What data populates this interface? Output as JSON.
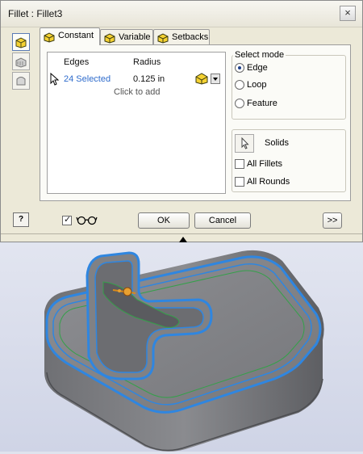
{
  "window": {
    "title": "Fillet : Fillet3",
    "close_glyph": "×"
  },
  "side_tools": [
    {
      "icon": "edge-fillet-icon",
      "active": true
    },
    {
      "icon": "face-fillet-icon",
      "active": false
    },
    {
      "icon": "full-round-fillet-icon",
      "active": false
    }
  ],
  "tabs": [
    {
      "label": "Constant",
      "active": true
    },
    {
      "label": "Variable",
      "active": false
    },
    {
      "label": "Setbacks",
      "active": false
    }
  ],
  "table": {
    "columns": [
      "Edges",
      "Radius"
    ],
    "rows": [
      {
        "edges": "24 Selected",
        "radius": "0.125 in"
      }
    ],
    "add_row_text": "Click to add"
  },
  "select_mode": {
    "title": "Select mode",
    "options": [
      {
        "label": "Edge",
        "checked": true
      },
      {
        "label": "Loop",
        "checked": false
      },
      {
        "label": "Feature",
        "checked": false
      }
    ]
  },
  "solids": {
    "label": "Solids",
    "all_fillets": {
      "label": "All Fillets",
      "checked": false
    },
    "all_rounds": {
      "label": "All Rounds",
      "checked": false
    }
  },
  "footer": {
    "help_label": "?",
    "preview_checked": true,
    "ok_label": "OK",
    "cancel_label": "Cancel",
    "more_label": ">>"
  },
  "colors": {
    "selection_blue": "#2f6ccc",
    "edge_highlight": "#3a8ee6",
    "model_gray": "#7f8084"
  }
}
